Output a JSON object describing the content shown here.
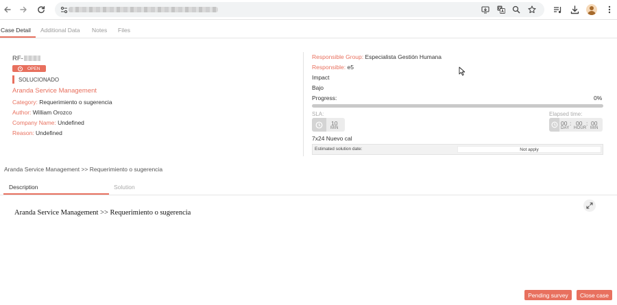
{
  "browser": {
    "icons": [
      "back-arrow-icon",
      "forward-arrow-icon",
      "reload-icon",
      "site-info-icon",
      "install-icon",
      "translate-icon",
      "zoom-icon",
      "bookmark-star-icon",
      "reading-list-icon",
      "download-icon",
      "profile-avatar-icon",
      "more-vert-icon"
    ]
  },
  "tabs": [
    "Case Detail",
    "Additional Data",
    "Notes",
    "Files"
  ],
  "case": {
    "id_prefix": "RF-",
    "status_badge": "OPEN",
    "state": "SOLUCIONADO",
    "service": "Aranda Service Management",
    "category_label": "Category:",
    "category": "Requerimiento o sugerencia",
    "author_label": "Author:",
    "author": "William Orozco",
    "company_label": "Company Name:",
    "company": "Undefined",
    "reason_label": "Reason:",
    "reason": "Undefined"
  },
  "details": {
    "group_label": "Responsible Group:",
    "group": "Especialista Gestión Humana",
    "responsible_label": "Responsible:",
    "responsible": "e5",
    "impact_label": "Impact",
    "impact": "Bajo",
    "progress_label": "Progress:",
    "progress_text": "0%",
    "progress_value": 0,
    "sla_label": "SLA:",
    "sla_value": "10",
    "sla_unit": "MIN",
    "elapsed_label": "Elapsed time:",
    "elapsed_day": "00",
    "elapsed_hour": "00",
    "elapsed_min": "00",
    "day_unit": "DAY",
    "hour_unit": "HOUR",
    "min_unit": "MIN",
    "sep": ":",
    "calendar": "7x24 Nuevo cal",
    "est_label": "Estimated solution date:",
    "est_value": "Not apply"
  },
  "breadcrumb": "Aranda Service Management >> Requerimiento o sugerencia",
  "inner_tabs": [
    "Description",
    "Solution"
  ],
  "description": "Aranda Service Management >> Requerimiento o sugerencia",
  "buttons": {
    "pending_survey": "Pending survey",
    "close_case": "Close case"
  },
  "colors": {
    "accent": "#e8705e",
    "muted": "#9b9b9b",
    "track": "#c9c9c9"
  }
}
